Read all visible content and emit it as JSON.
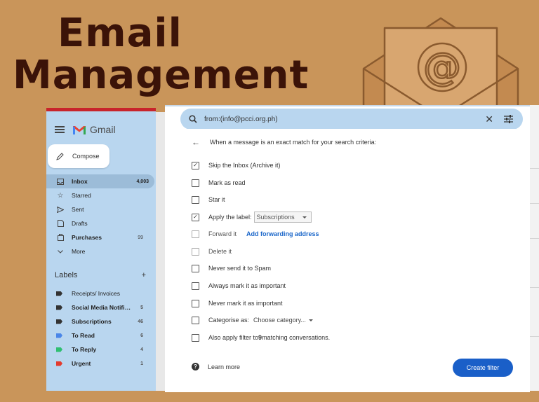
{
  "headline": {
    "line1": "Email",
    "line2": "Management"
  },
  "sidebar": {
    "app_name": "Gmail",
    "compose_label": "Compose",
    "nav": [
      {
        "label": "Inbox",
        "count": "4,003",
        "icon": "inbox-icon"
      },
      {
        "label": "Starred",
        "count": "",
        "icon": "star-icon"
      },
      {
        "label": "Sent",
        "count": "",
        "icon": "send-icon"
      },
      {
        "label": "Drafts",
        "count": "",
        "icon": "draft-icon"
      },
      {
        "label": "Purchases",
        "count": "99",
        "icon": "tag-icon"
      },
      {
        "label": "More",
        "count": "",
        "icon": "chevron-down-icon"
      }
    ],
    "labels_heading": "Labels",
    "labels_add": "+",
    "labels": [
      {
        "label": "Receipts/ Invoices",
        "count": "",
        "color": "#333333"
      },
      {
        "label": "Social Media Notifi…",
        "count": "5",
        "color": "#333333"
      },
      {
        "label": "Subscriptions",
        "count": "46",
        "color": "#333333"
      },
      {
        "label": "To Read",
        "count": "6",
        "color": "#4a86e8"
      },
      {
        "label": "To Reply",
        "count": "4",
        "color": "#2fbf71"
      },
      {
        "label": "Urgent",
        "count": "1",
        "color": "#e33b2e"
      }
    ]
  },
  "search": {
    "query": "from:(info@pcci.org.ph)",
    "close": "✕"
  },
  "filter": {
    "intro": "When a message is an exact match for your search criteria:",
    "options": {
      "skip_inbox": {
        "label": "Skip the Inbox (Archive it)",
        "checked": true
      },
      "mark_read": {
        "label": "Mark as read",
        "checked": false
      },
      "star": {
        "label": "Star it",
        "checked": false
      },
      "apply_label": {
        "label": "Apply the label:",
        "checked": true,
        "value": "Subscriptions"
      },
      "forward": {
        "label": "Forward it",
        "checked": false,
        "link": "Add forwarding address"
      },
      "delete": {
        "label": "Delete it",
        "checked": false
      },
      "never_spam": {
        "label": "Never send it to Spam",
        "checked": false
      },
      "always_important": {
        "label": "Always mark it as important",
        "checked": false
      },
      "never_important": {
        "label": "Never mark it as important",
        "checked": false
      },
      "categorise": {
        "label": "Categorise as:",
        "checked": false,
        "value": "Choose category..."
      },
      "also_apply": {
        "label_pre": "Also apply filter to ",
        "count": "9",
        "label_post": " matching conversations.",
        "checked": false
      }
    },
    "learn_more": "Learn more",
    "create_button": "Create filter"
  },
  "colors": {
    "background": "#c9955a",
    "headline": "#3b1308",
    "sidebar": "#b9d6ef",
    "primary_button": "#1a5fc8",
    "link": "#1a66c9"
  }
}
